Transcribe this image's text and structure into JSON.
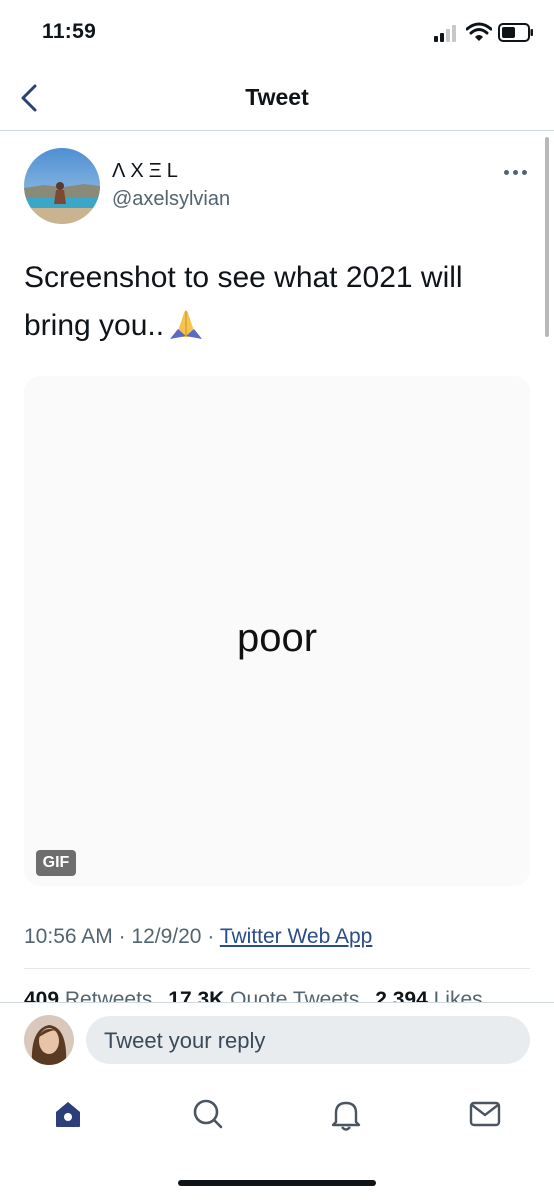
{
  "status_bar": {
    "time": "11:59"
  },
  "nav": {
    "title": "Tweet"
  },
  "tweet": {
    "display_name": "ΛXΞL",
    "handle": "@axelsylvian",
    "text": "Screenshot to see what 2021 will bring you..",
    "media": {
      "caption": "poor",
      "badge": "GIF"
    },
    "time": "10:56 AM",
    "date": "12/9/20",
    "source": "Twitter Web App",
    "separator": "·",
    "stats": {
      "retweets_count": "409",
      "retweets_label": "Retweets",
      "quotes_count": "17.3K",
      "quotes_label": "Quote Tweets",
      "likes_count": "2,394",
      "likes_label": "Likes"
    }
  },
  "reply": {
    "placeholder": "Tweet your reply"
  },
  "tab_bar": {
    "tabs": [
      "home-icon",
      "search-icon",
      "bell-icon",
      "mail-icon"
    ]
  },
  "colors": {
    "accent": "#2b3f7a",
    "link": "#2b4c8a",
    "text": "#0f1419",
    "secondary": "#536471"
  }
}
